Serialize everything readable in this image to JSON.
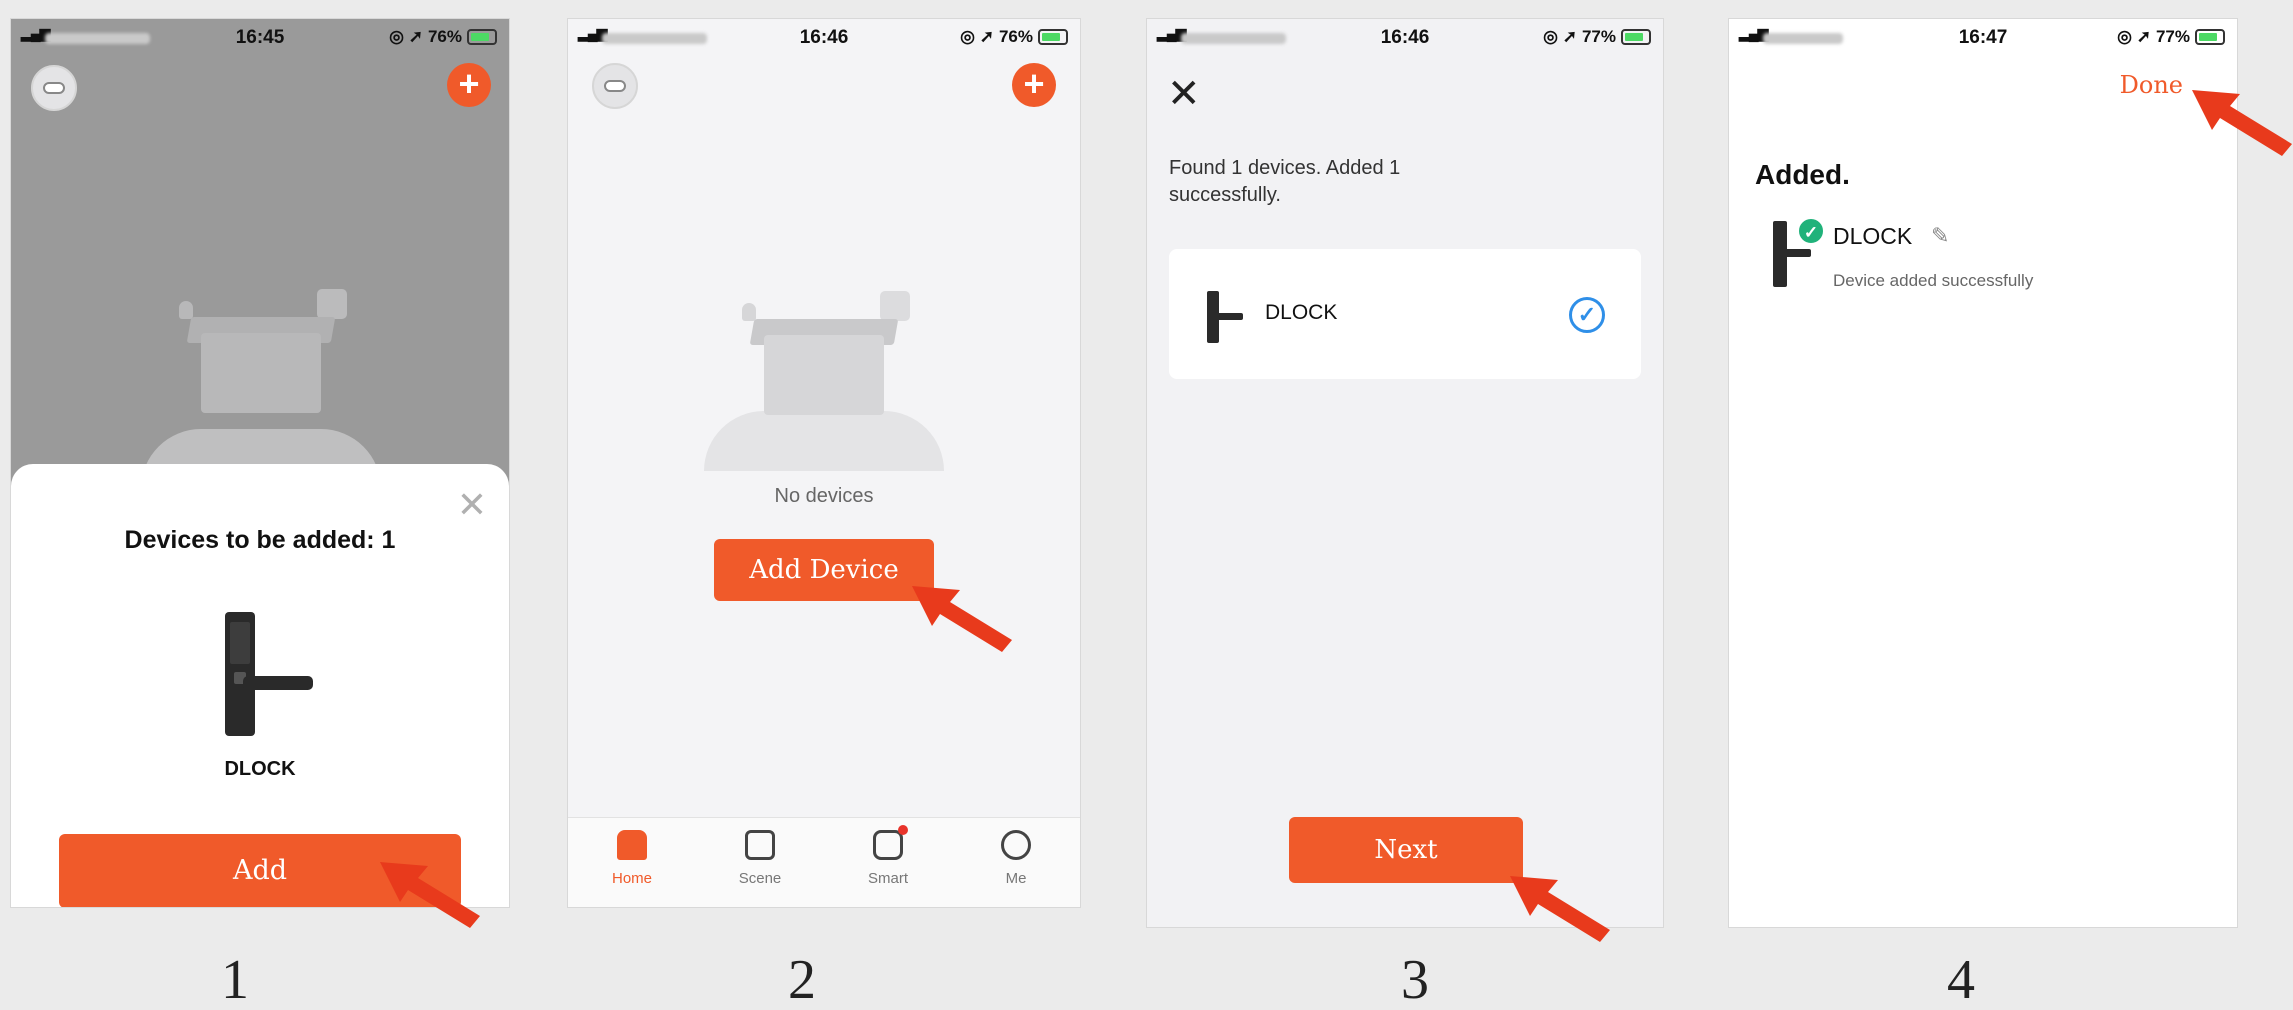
{
  "colors": {
    "accent": "#f05a2a",
    "check_blue": "#2f8fe8",
    "success_green": "#20b27a"
  },
  "steps": [
    {
      "status": {
        "time": "16:45",
        "battery": "76%"
      },
      "sheet_title": "Devices to be added: 1",
      "device_name": "DLOCK",
      "add_label": "Add",
      "number": "1"
    },
    {
      "status": {
        "time": "16:46",
        "battery": "76%"
      },
      "empty_text": "No devices",
      "add_device_label": "Add Device",
      "tabs": [
        {
          "label": "Home",
          "icon": "home-icon"
        },
        {
          "label": "Scene",
          "icon": "scene-icon"
        },
        {
          "label": "Smart",
          "icon": "smart-icon"
        },
        {
          "label": "Me",
          "icon": "me-icon"
        }
      ],
      "number": "2"
    },
    {
      "status": {
        "time": "16:46",
        "battery": "77%"
      },
      "found_text": "Found 1 devices. Added 1 successfully.",
      "device_name": "DLOCK",
      "next_label": "Next",
      "number": "3"
    },
    {
      "status": {
        "time": "16:47",
        "battery": "77%"
      },
      "done_label": "Done",
      "added_title": "Added.",
      "device_name": "DLOCK",
      "sub_text": "Device added successfully",
      "number": "4"
    }
  ]
}
